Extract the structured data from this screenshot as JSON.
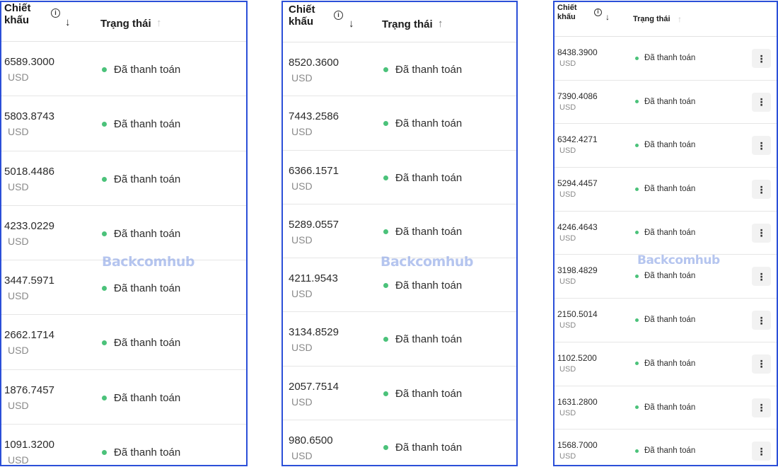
{
  "header": {
    "discount_label": "Chiết\nkhấu",
    "info_icon_glyph": "i",
    "sort_down_glyph": "↓",
    "status_label": "Trạng thái",
    "sort_up_glyph": "↑"
  },
  "currency": "USD",
  "status_text": "Đã thanh toán",
  "status_color": "#4bc27a",
  "menu_glyph": "⋮",
  "watermark": "Backcomhub",
  "panels": [
    {
      "amounts": [
        "6589.3000",
        "5803.8743",
        "5018.4486",
        "4233.0229",
        "3447.5971",
        "2662.1714",
        "1876.7457",
        "1091.3200"
      ]
    },
    {
      "amounts": [
        "8520.3600",
        "7443.2586",
        "6366.1571",
        "5289.0557",
        "4211.9543",
        "3134.8529",
        "2057.7514",
        "980.6500"
      ]
    },
    {
      "amounts": [
        "8438.3900",
        "7390.4086",
        "6342.4271",
        "5294.4457",
        "4246.4643",
        "3198.4829",
        "2150.5014",
        "1102.5200",
        "1631.2800",
        "1568.7000"
      ]
    }
  ]
}
